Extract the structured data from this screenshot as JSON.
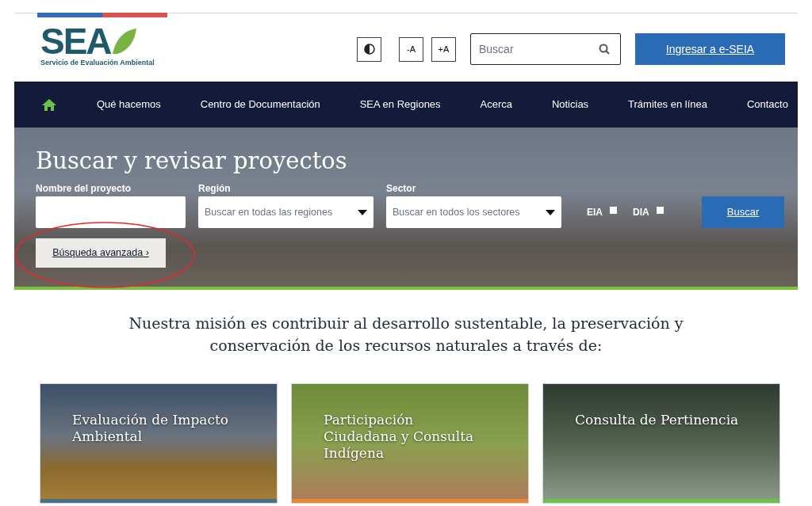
{
  "logo": {
    "text": "SEA",
    "subtitle": "Servicio de Evaluación Ambiental"
  },
  "tools": {
    "font_smaller": "-A",
    "font_larger": "+A"
  },
  "search": {
    "placeholder": "Buscar"
  },
  "login_button": "Ingresar a e-SEIA",
  "nav": [
    "Qué hacemos",
    "Centro de Documentación",
    "SEA en Regiones",
    "Acerca",
    "Noticias",
    "Trámites en línea",
    "Contacto"
  ],
  "hero": {
    "title": "Buscar y revisar proyectos",
    "fields": [
      {
        "kind": "text",
        "label": "Nombre del proyecto"
      },
      {
        "kind": "select",
        "label": "Región",
        "placeholder": "Buscar en todas las regiones"
      },
      {
        "kind": "select",
        "label": "Sector",
        "placeholder": "Buscar en todos los sectores"
      }
    ],
    "checkboxes": [
      {
        "label": "EIA",
        "checked": false
      },
      {
        "label": "DIA",
        "checked": false
      }
    ],
    "search_button": "Buscar",
    "advanced_button": "Búsqueda avanzada ›"
  },
  "mission": "Nuestra misión es contribuir al desarrollo sustentable, la preservación y conservación de los recursos naturales a través de:",
  "cards": [
    {
      "title": "Evaluación de Impacto Ambiental",
      "color": "#4a6f8a"
    },
    {
      "title": "Participación Ciudadana y Consulta Indígena",
      "color": "#e9892f"
    },
    {
      "title": "Consulta de Pertinencia",
      "color": "#6cc04a"
    }
  ]
}
